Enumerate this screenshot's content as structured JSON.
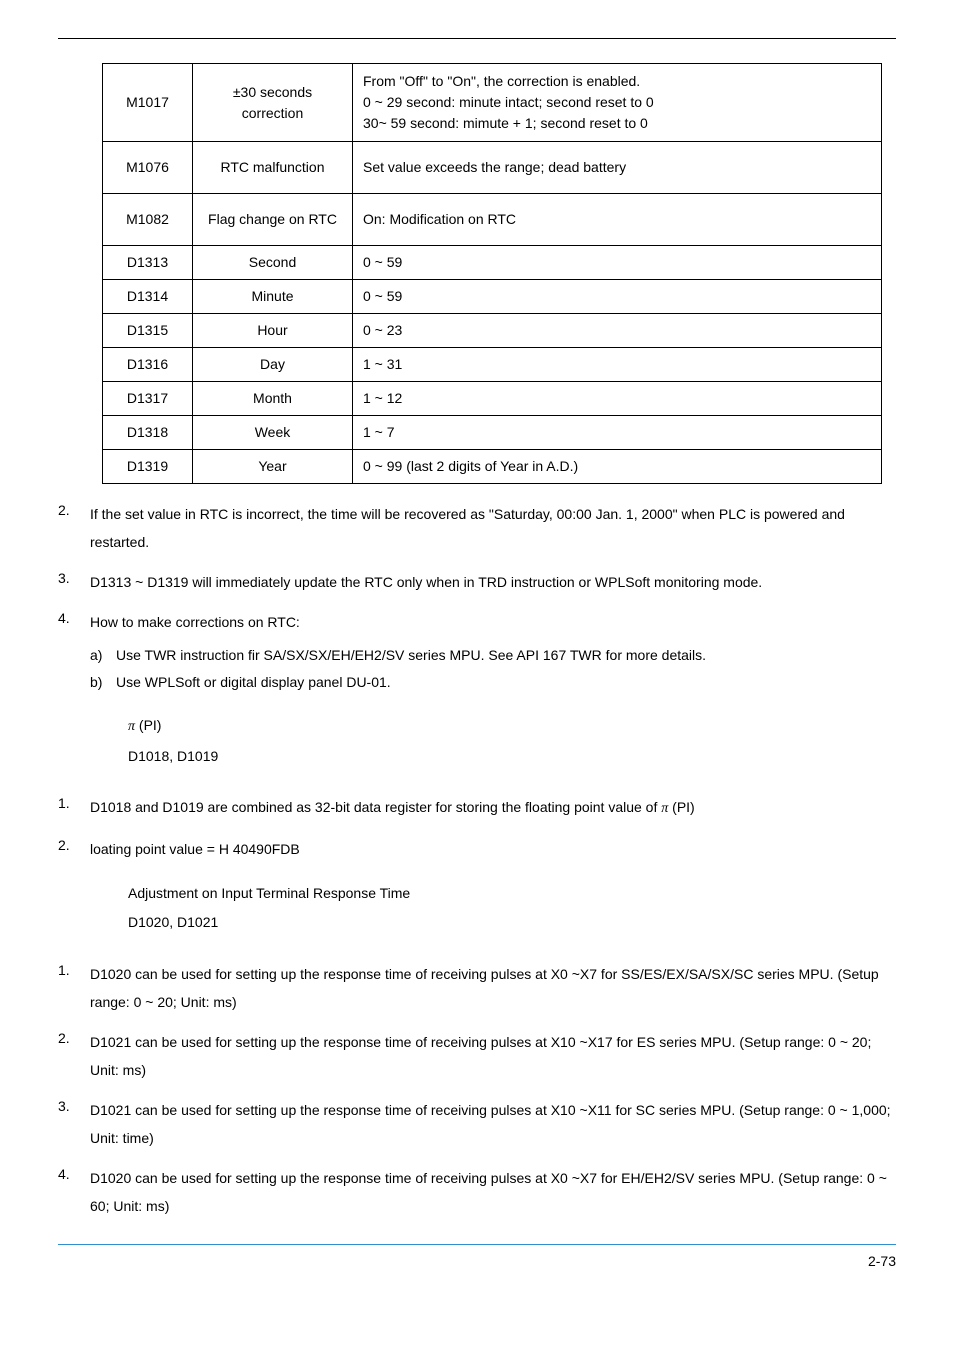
{
  "table": {
    "rows": [
      {
        "c0": "M1017",
        "c1": "±30 seconds correction",
        "c2": "From \"Off\" to \"On\", the correction is enabled.\n0 ~ 29 second: minute intact; second reset to 0\n30~ 59 second: mimute + 1; second reset to 0",
        "h": "tall"
      },
      {
        "c0": "M1076",
        "c1": "RTC malfunction",
        "c2": "Set value exceeds the range; dead battery",
        "h": "med"
      },
      {
        "c0": "M1082",
        "c1": "Flag change on RTC",
        "c2": "On: Modification on RTC",
        "h": "med"
      },
      {
        "c0": "D1313",
        "c1": "Second",
        "c2": "0 ~ 59",
        "h": ""
      },
      {
        "c0": "D1314",
        "c1": "Minute",
        "c2": "0 ~ 59",
        "h": ""
      },
      {
        "c0": "D1315",
        "c1": "Hour",
        "c2": "0 ~ 23",
        "h": ""
      },
      {
        "c0": "D1316",
        "c1": "Day",
        "c2": "1 ~ 31",
        "h": ""
      },
      {
        "c0": "D1317",
        "c1": "Month",
        "c2": "1 ~ 12",
        "h": ""
      },
      {
        "c0": "D1318",
        "c1": "Week",
        "c2": "1 ~ 7",
        "h": ""
      },
      {
        "c0": "D1319",
        "c1": "Year",
        "c2": "0 ~ 99 (last 2 digits of Year in A.D.)",
        "h": ""
      }
    ]
  },
  "listA": {
    "n2": "2.",
    "t2": "If the set value in RTC is incorrect, the time will be recovered as \"Saturday, 00:00 Jan. 1, 2000\" when PLC is powered and restarted.",
    "n3": "3.",
    "t3": "D1313 ~ D1319 will immediately update the RTC only when in TRD instruction or WPLSoft monitoring mode.",
    "n4": "4.",
    "t4": "How to make corrections on RTC:",
    "a_m": "a)",
    "a_t": "Use TWR instruction fir SA/SX/SX/EH/EH2/SV series MPU. See API 167 TWR for more details.",
    "b_m": "b)",
    "b_t": "Use WPLSoft or digital display panel DU-01."
  },
  "secPI": {
    "l1a": "π",
    "l1b": "(PI)",
    "l2": "D1018, D1019"
  },
  "listB": {
    "n1": "1.",
    "t1a": "D1018 and D1019 are combined as 32-bit data register for storing the floating point value of",
    "t1b": "π",
    "t1c": "(PI)",
    "n2": "2.",
    "t2": "loating point value = H 40490FDB"
  },
  "secAdj": {
    "l1": "Adjustment on Input Terminal Response Time",
    "l2": "D1020, D1021"
  },
  "listC": {
    "n1": "1.",
    "t1": "D1020 can be used for setting up the response time of receiving pulses at X0 ~X7 for SS/ES/EX/SA/SX/SC series MPU. (Setup range: 0 ~ 20; Unit: ms)",
    "n2": "2.",
    "t2": "D1021 can be used for setting up the response time of receiving pulses at X10 ~X17 for ES series MPU. (Setup range: 0 ~ 20; Unit: ms)",
    "n3": "3.",
    "t3": "D1021 can be used for setting up the response time of receiving pulses at X10 ~X11 for SC series MPU. (Setup range: 0 ~ 1,000; Unit: time)",
    "n4": "4.",
    "t4": "D1020 can be used for setting up the response time of receiving pulses at X0 ~X7 for EH/EH2/SV series MPU. (Setup range: 0 ~ 60; Unit: ms)"
  },
  "footer": {
    "page": "2-73"
  }
}
